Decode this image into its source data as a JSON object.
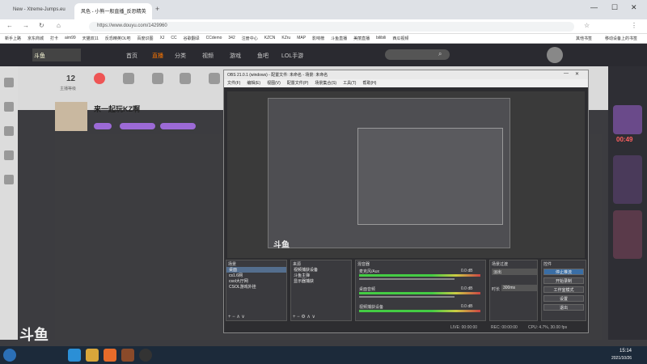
{
  "browser": {
    "tabs": [
      "New - Xtreme-Jumps.eu",
      "风色 - 小熊一般直播_反恐精英"
    ],
    "url": "https://www.douyu.com/1429960",
    "bookmarks": [
      "新手上路",
      "京东商城",
      "打卡",
      "aim99",
      "天猫双11",
      "反恐精英OL吧",
      "百度识图",
      "XJ",
      "CC",
      "谷歌翻译",
      "CCdemo",
      "342",
      "注册中心",
      "KZCN",
      "KZru",
      "MAP",
      "影响榜",
      "斗鱼直播",
      "美丽直播",
      "bilibili",
      "西瓜视频"
    ],
    "right_bookmarks": [
      "其他书签",
      "移动设备上的书签"
    ]
  },
  "douyu": {
    "nav": [
      "首页",
      "直播",
      "分类",
      "视频",
      "游戏",
      "鱼吧",
      "LOL手游"
    ],
    "stats": [
      {
        "value": "12",
        "label": "主播等级"
      }
    ],
    "streamer_name": "来一起玩KZ啊",
    "watermark": "斗鱼",
    "timer": "00:49"
  },
  "obs": {
    "title": "OBS 21.0.1 (windows) - 配置文件: 未命名 - 场景: 未命名",
    "menu": [
      "文件(F)",
      "编辑(E)",
      "视图(V)",
      "配置文件(P)",
      "场景集合(S)",
      "工具(T)",
      "帮助(H)"
    ],
    "panels": {
      "scenes": {
        "title": "场景",
        "items": [
          "桌面",
          "cs1.6网",
          "csol大厅网",
          "CSOL游戏外挂"
        ]
      },
      "sources": {
        "title": "来源",
        "items": [
          "视频捕获设备",
          "斗鱼主弹",
          "显示器捕获"
        ]
      },
      "mixer": {
        "title": "混音器",
        "tracks": [
          {
            "name": "麦克风/Aux",
            "db": "0.0 dB"
          },
          {
            "name": "桌面音频",
            "db": "0.0 dB"
          },
          {
            "name": "视频捕获设备",
            "db": "0.0 dB"
          }
        ]
      },
      "transitions": {
        "title": "场景过渡",
        "select": "淡出",
        "duration_label": "时长",
        "duration": "300ms"
      },
      "controls": {
        "title": "控件",
        "buttons": [
          "停止推流",
          "开始录制",
          "工作室模式",
          "设置",
          "退出"
        ]
      }
    },
    "status": {
      "lost": "LIVE: 00:00:00",
      "rec": "REC: 00:00:00",
      "cpu": "CPU: 4.7%, 30.00 fps"
    }
  },
  "taskbar": {
    "clock": "15:14",
    "date": "2021/10/26"
  },
  "colors": {
    "accent": "#ff7700",
    "obs_bg": "#2d2d30",
    "selected": "#546e8e"
  }
}
